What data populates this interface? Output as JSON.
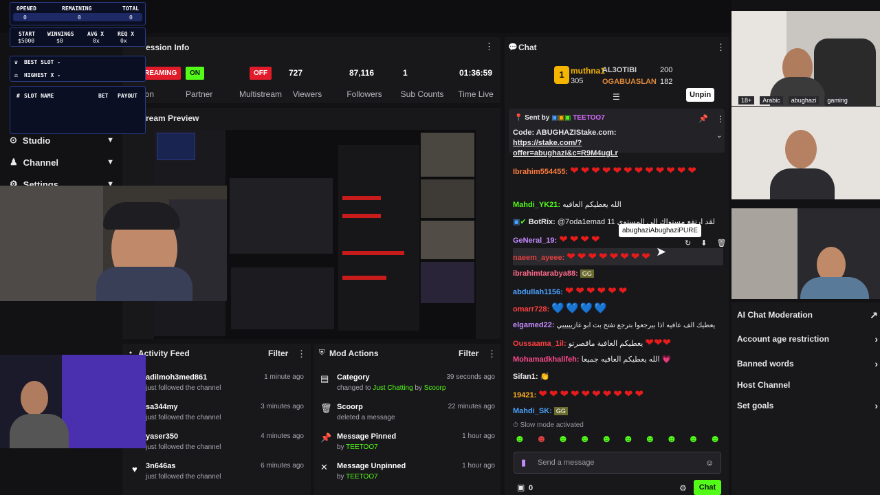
{
  "overlay": {
    "opened_label": "OPENED",
    "remaining_label": "REMAINING",
    "total_label": "TOTAL",
    "opened_val": "0",
    "remaining_val": "0",
    "total_val": "0",
    "start_label": "START",
    "winnings_label": "WINNINGS",
    "avgx_label": "AVG X",
    "reqx_label": "REQ X",
    "start_val": "$5000",
    "winnings_val": "$0",
    "avgx_val": "0x",
    "reqx_val": "0x",
    "best_slot": "BEST SLOT -",
    "highest_x": "HIGHEST X -",
    "col_hash": "#",
    "col_slot": "SLOT NAME",
    "col_bet": "BET",
    "col_payout": "PAYOUT"
  },
  "nav": {
    "studio": "Studio",
    "channel": "Channel",
    "settings": "Settings"
  },
  "session": {
    "title": "ession Info",
    "streaming_badge": "REAMING",
    "streaming_label": "ion",
    "partner_badge": "ON",
    "partner_label": "Partner",
    "multistream_badge": "OFF",
    "multistream_label": "Multistream",
    "viewers_val": "727",
    "viewers_label": "Viewers",
    "followers_val": "87,116",
    "followers_label": "Followers",
    "subs_val": "1",
    "subs_label": "Sub Counts",
    "time_val": "01:36:59",
    "time_label": "Time Live"
  },
  "preview": {
    "title": "ream Preview"
  },
  "activity": {
    "title": "Activity Feed",
    "filter": "Filter",
    "items": [
      {
        "name": "adilmoh3med861",
        "sub": "just followed the channel",
        "time": "1 minute ago"
      },
      {
        "name": "sa344my",
        "sub": "just followed the channel",
        "time": "3 minutes ago"
      },
      {
        "name": "yaser350",
        "sub": "just followed the channel",
        "time": "4 minutes ago"
      },
      {
        "name": "3n646as",
        "sub": "just followed the channel",
        "time": "6 minutes ago"
      }
    ]
  },
  "mod": {
    "title": "Mod Actions",
    "filter": "Filter",
    "items": [
      {
        "name": "Category",
        "sub_a": "changed to ",
        "sub_b": "Just Chatting",
        "sub_c": " by ",
        "sub_d": "Scoorp",
        "time": "39 seconds ago"
      },
      {
        "name": "Scoorp",
        "sub_a": "deleted a message",
        "time": "22 minutes ago"
      },
      {
        "name": "Message Pinned",
        "sub_a": "by ",
        "sub_b": "TEETOO7",
        "time": "1 hour ago"
      },
      {
        "name": "Message Unpinned",
        "sub_a": "by ",
        "sub_b": "TEETOO7",
        "time": "1 hour ago"
      }
    ]
  },
  "chat": {
    "title": "Chat",
    "leader1": "muthna1",
    "leader1_count": "305",
    "leader2": "AL3OTIBI",
    "leader2_count": "200",
    "leader3": "OGABUASLAN",
    "leader3_count": "182",
    "unpin": "Unpin",
    "pinned_sender_label": "Sent by",
    "pinned_sender": "TEETOO7",
    "pinned_code": "Code: ABUGHAZIStake.com: ",
    "pinned_link": "https://stake.com/?offer=abughazi&c=R9M4ugLr",
    "tooltip": "abughaziAbughaziPURE",
    "messages": [
      {
        "user": "Ibrahim554455:",
        "color": "#ff7a3c",
        "hearts": "❤❤❤❤❤❤❤❤❤❤❤❤"
      },
      {
        "user": "Mahdi_YK21:",
        "color": "#53fc18",
        "text": "الله يعطيكم العافيه"
      },
      {
        "user": "BotRix:",
        "color": "#ffffff",
        "text": "@7oda1emad 11 لقد ارتفع مستواك إلى المستوى"
      },
      {
        "user": "GeNeral_19:",
        "color": "#c58bff",
        "hearts": "❤❤❤❤"
      },
      {
        "user": "naeem_ayeee:",
        "color": "#e04040",
        "hearts": "❤❤❤❤❤❤❤❤"
      },
      {
        "user": "ibrahimtarabya88:",
        "color": "#ff6a8a",
        "text": "GG"
      },
      {
        "user": "abdullah1156:",
        "color": "#4aa3ff",
        "hearts": "❤❤❤❤❤❤"
      },
      {
        "user": "omarr728:",
        "color": "#ff4040",
        "bhearts": "💙💙💙💙"
      },
      {
        "user": "elgamed22:",
        "color": "#c58bff",
        "text": "يعطيك الف عافيه اذا بيرجعوا بترجع تفتح بث ابو غازيييييي"
      },
      {
        "user": "Oussaama_1il:",
        "color": "#ff4040",
        "text": "يعطيكم العافية ماقصرتو",
        "hearts": "❤❤❤"
      },
      {
        "user": "Mohamadkhalifeh:",
        "color": "#ff4a8a",
        "text": "الله يعطيكم العافيه جميعا 💗"
      },
      {
        "user": "Sifan1:",
        "color": "#ffffff",
        "text": "👏"
      },
      {
        "user": "19421:",
        "color": "#ffb020",
        "hearts": "❤❤❤❤❤❤❤❤❤❤"
      },
      {
        "user": "Mahdi_SK:",
        "color": "#4aa3ff",
        "text": "GG"
      }
    ],
    "slow_mode": "Slow mode activated",
    "input_placeholder": "Send a message",
    "points": "0",
    "chat_button": "Chat"
  },
  "cams": {
    "tag1": "18+",
    "tag2": "Arabic",
    "tag3": "abughazi",
    "tag4": "gaming"
  },
  "right_menu": {
    "ai_mod": "AI Chat Moderation",
    "age": "Account age restriction",
    "banned": "Banned words",
    "host": "Host Channel",
    "goals": "Set goals"
  }
}
